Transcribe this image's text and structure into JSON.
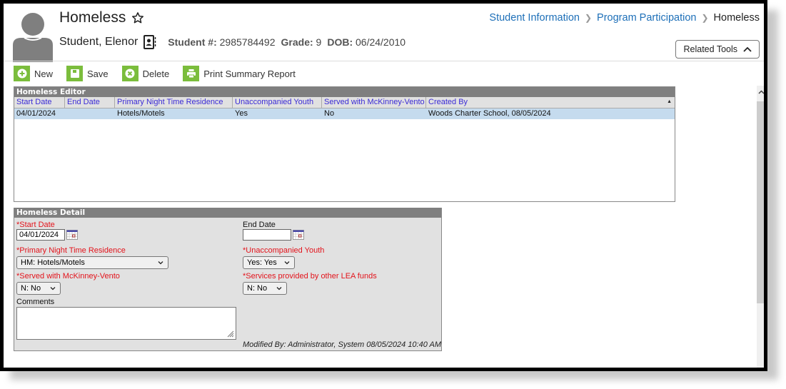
{
  "header": {
    "title": "Homeless",
    "student_name": "Student, Elenor",
    "student_number_label": "Student #:",
    "student_number": "2985784492",
    "grade_label": "Grade:",
    "grade": "9",
    "dob_label": "DOB:",
    "dob": "06/24/2010"
  },
  "breadcrumb": {
    "items": [
      "Student Information",
      "Program Participation"
    ],
    "current": "Homeless"
  },
  "related_tools": {
    "label": "Related Tools"
  },
  "toolbar": {
    "new_label": "New",
    "save_label": "Save",
    "delete_label": "Delete",
    "print_label": "Print Summary Report"
  },
  "editor": {
    "title": "Homeless Editor",
    "columns": [
      "Start Date",
      "End Date",
      "Primary Night Time Residence",
      "Unaccompanied Youth",
      "Served with McKinney-Vento",
      "Created By"
    ],
    "rows": [
      [
        "04/01/2024",
        "",
        "Hotels/Motels",
        "Yes",
        "No",
        "Woods Charter School, 08/05/2024"
      ]
    ],
    "sort_indicator": "▲"
  },
  "detail": {
    "title": "Homeless Detail",
    "start_date": {
      "label": "*Start Date",
      "value": "04/01/2024"
    },
    "end_date": {
      "label": "End Date",
      "value": ""
    },
    "residence": {
      "label": "*Primary Night Time Residence",
      "value": "HM: Hotels/Motels"
    },
    "unaccompanied": {
      "label": "*Unaccompanied Youth",
      "value": "Yes: Yes"
    },
    "mckinney": {
      "label": "*Served with McKinney-Vento",
      "value": "N: No"
    },
    "lea_funds": {
      "label": "*Services provided by other LEA funds",
      "value": "N: No"
    },
    "comments": {
      "label": "Comments",
      "value": ""
    },
    "modified_by": "Modified By: Administrator, System 08/05/2024 10:40 AM"
  },
  "colors": {
    "accent_green": "#7bbd3c",
    "link_blue": "#1d6fb8",
    "grid_header_text": "#3a2ad6",
    "selected_row": "#c5dbee",
    "required_red": "#e3131b",
    "panel_header": "#7f7f7f"
  }
}
